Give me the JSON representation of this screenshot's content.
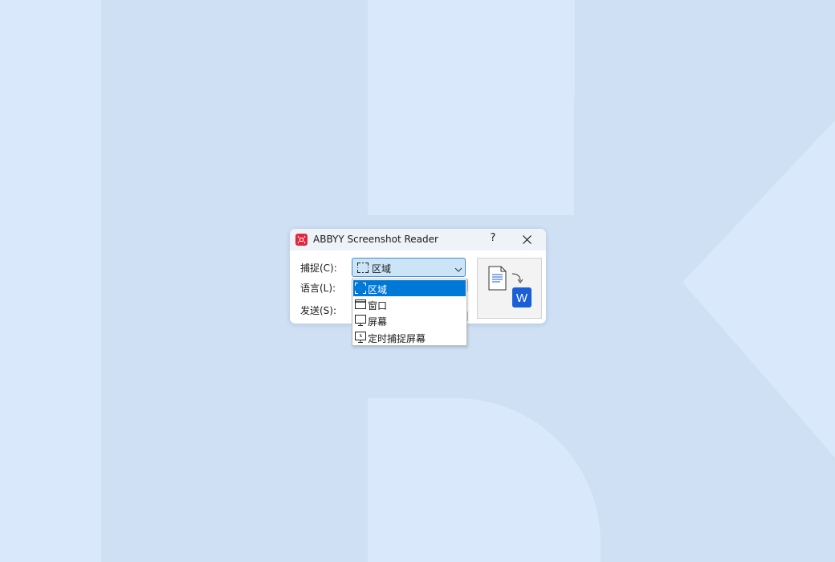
{
  "window": {
    "title": "ABBYY Screenshot Reader",
    "help_label": "?"
  },
  "form": {
    "capture_label": "捕捉(C):",
    "language_label": "语言(L):",
    "send_label": "发送(S):"
  },
  "capture_select": {
    "selected": "区域",
    "options": [
      {
        "label": "区域",
        "icon": "region-icon",
        "selected": true
      },
      {
        "label": "窗口",
        "icon": "window-icon",
        "selected": false
      },
      {
        "label": "屏幕",
        "icon": "screen-icon",
        "selected": false
      },
      {
        "label": "定时捕捉屏幕",
        "icon": "timed-screen-icon",
        "selected": false
      }
    ]
  },
  "convert_button": {
    "target_letter": "W"
  },
  "colors": {
    "accent": "#0078d7",
    "app_icon": "#e8233a",
    "word_blue": "#1a5fd6",
    "background": "#dae8fb"
  }
}
